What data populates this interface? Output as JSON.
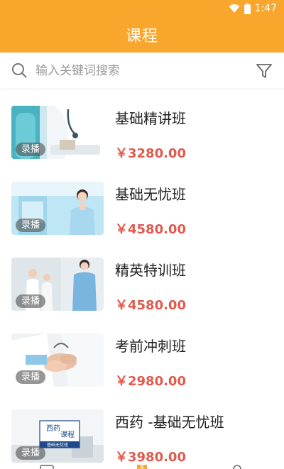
{
  "status_bar": {
    "time": "1:47",
    "icons": [
      "wifi-icon",
      "battery-icon"
    ]
  },
  "header": {
    "title": "课程",
    "bg_color": "#f9a62d"
  },
  "search": {
    "placeholder": "输入关键词搜索",
    "value": ""
  },
  "courses": [
    {
      "name": "基础精讲班",
      "price": "￥3280.00",
      "badge": "录播"
    },
    {
      "name": "基础无忧班",
      "price": "￥4580.00",
      "badge": "录播"
    },
    {
      "name": "精英特训班",
      "price": "￥4580.00",
      "badge": "录播"
    },
    {
      "name": "考前冲刺班",
      "price": "￥2980.00",
      "badge": "录播"
    },
    {
      "name": "西药 -基础无忧班",
      "price": "￥3980.00",
      "badge": "录播"
    }
  ],
  "thumb_texts": {
    "line1": "西药",
    "line2": "课程",
    "line3": "基础无忧班"
  },
  "colors": {
    "accent": "#f9a62d",
    "price": "#e05a4e"
  }
}
